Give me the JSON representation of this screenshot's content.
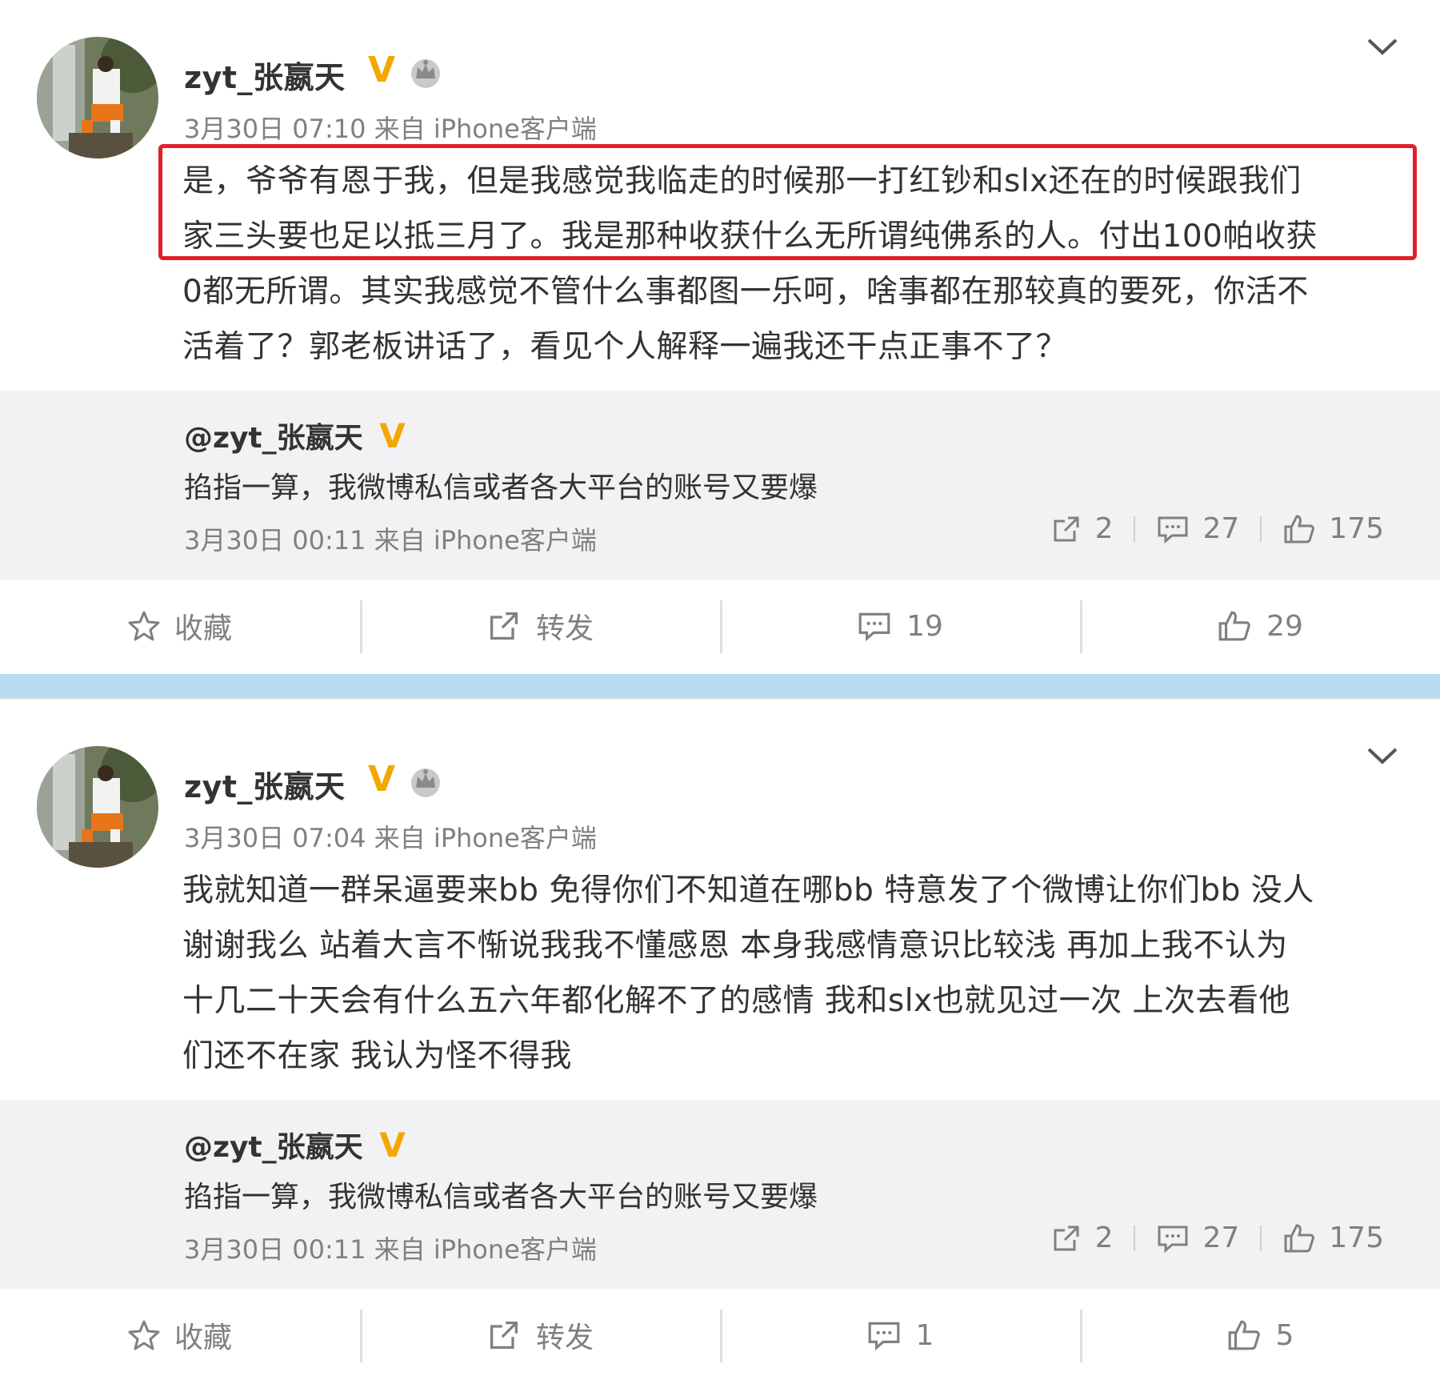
{
  "posts": [
    {
      "username": "zyt_张嬴天",
      "verified": "V",
      "meta": "3月30日 07:10 来自 iPhone客户端",
      "body_lines": [
        "是，爷爷有恩于我，但是我感觉我临走的时候那一打红钞和slx还在的时候跟我们",
        "家三头要也足以抵三月了。我是那种收获什么无所谓纯佛系的人。付出100帕收获",
        "0都无所谓。其实我感觉不管什么事都图一乐呵，啥事都在那较真的要死，你活不",
        "活着了？郭老板讲话了，看见个人解释一遍我还干点正事不了？"
      ],
      "quoted": {
        "username": "@zyt_张嬴天",
        "verified": "V",
        "text": "掐指一算，我微博私信或者各大平台的账号又要爆",
        "meta": "3月30日 00:11 来自 iPhone客户端",
        "reposts": "2",
        "comments": "27",
        "likes": "175"
      },
      "actions": {
        "favorite": "收藏",
        "repost": "转发",
        "comments": "19",
        "likes": "29"
      }
    },
    {
      "username": "zyt_张嬴天",
      "verified": "V",
      "meta": "3月30日 07:04 来自 iPhone客户端",
      "body_lines": [
        "我就知道一群呆逼要来bb 免得你们不知道在哪bb 特意发了个微博让你们bb 没人",
        "谢谢我么 站着大言不惭说我我不懂感恩 本身我感情意识比较浅 再加上我不认为",
        "十几二十天会有什么五六年都化解不了的感情 我和slx也就见过一次 上次去看他",
        "们还不在家 我认为怪不得我"
      ],
      "quoted": {
        "username": "@zyt_张嬴天",
        "verified": "V",
        "text": "掐指一算，我微博私信或者各大平台的账号又要爆",
        "meta": "3月30日 00:11 来自 iPhone客户端",
        "reposts": "2",
        "comments": "27",
        "likes": "175"
      },
      "actions": {
        "favorite": "收藏",
        "repost": "转发",
        "comments": "1",
        "likes": "5"
      }
    }
  ],
  "colors": {
    "highlight": "#e0202a",
    "verified": "#f4a700",
    "divider": "#b8dcef",
    "quote_bg": "#f2f2f5"
  },
  "icons": [
    "chevron-down-icon",
    "crown-icon",
    "repost-icon",
    "comment-icon",
    "like-icon",
    "star-icon"
  ]
}
